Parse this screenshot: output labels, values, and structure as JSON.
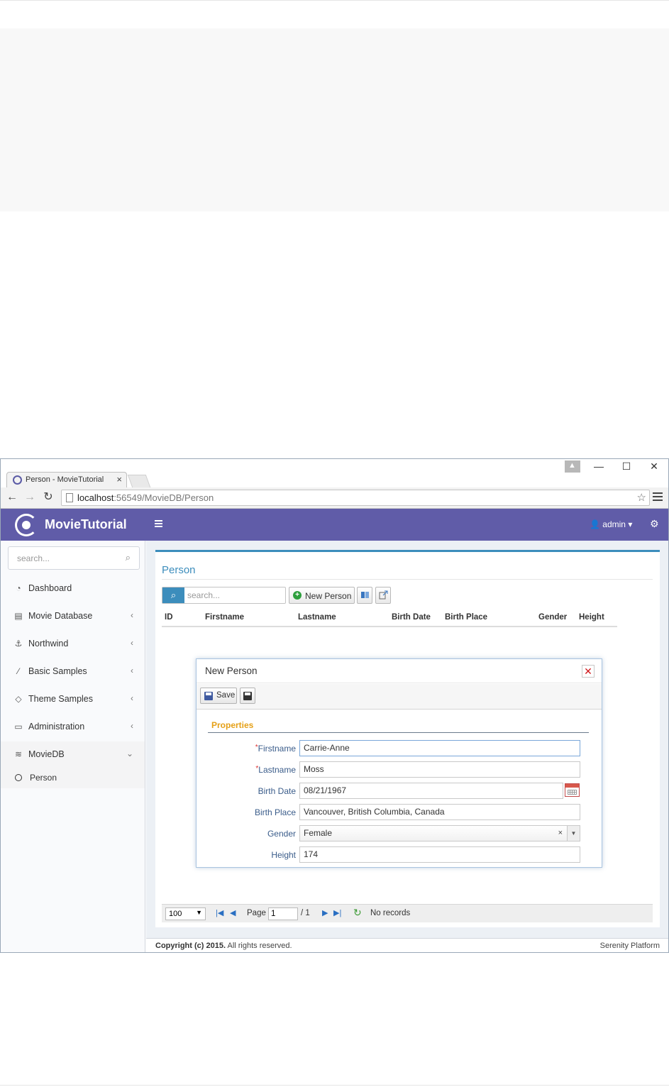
{
  "browser": {
    "tab_title": "Person - MovieTutorial",
    "tab_close": "×",
    "url_host": "localhost",
    "url_rest": ":56549/MovieDB/Person",
    "controls": {
      "minimize": "—",
      "maximize": "☐",
      "close": "✕"
    }
  },
  "app": {
    "logo_text": "MovieTutorial",
    "user_label": "admin",
    "accent_color": "#605ca8"
  },
  "sidebar": {
    "search_placeholder": "search...",
    "items": [
      {
        "label": "Dashboard",
        "icon": "dashboard-icon",
        "has_children": false
      },
      {
        "label": "Movie Database",
        "icon": "film-icon",
        "has_children": true
      },
      {
        "label": "Northwind",
        "icon": "anchor-icon",
        "has_children": true
      },
      {
        "label": "Basic Samples",
        "icon": "magic-wand-icon",
        "has_children": true
      },
      {
        "label": "Theme Samples",
        "icon": "diamond-icon",
        "has_children": true
      },
      {
        "label": "Administration",
        "icon": "desktop-icon",
        "has_children": true
      },
      {
        "label": "MovieDB",
        "icon": "stack-icon",
        "has_children": true,
        "expanded": true
      }
    ],
    "sub_items": [
      {
        "label": "Person",
        "icon": "circle-icon"
      }
    ]
  },
  "grid": {
    "title": "Person",
    "search_placeholder": "search...",
    "new_button": "New Person",
    "columns": [
      "ID",
      "Firstname",
      "Lastname",
      "Birth Date",
      "Birth Place",
      "Gender",
      "Height"
    ]
  },
  "pager": {
    "page_size": "100",
    "page_label": "Page",
    "page_value": "1",
    "page_total": "/ 1",
    "status": "No records"
  },
  "dialog": {
    "title": "New Person",
    "save_label": "Save",
    "category": "Properties",
    "fields": [
      {
        "label": "Firstname",
        "required": true,
        "value": "Carrie-Anne"
      },
      {
        "label": "Lastname",
        "required": true,
        "value": "Moss"
      },
      {
        "label": "Birth Date",
        "required": false,
        "value": "08/21/1967"
      },
      {
        "label": "Birth Place",
        "required": false,
        "value": "Vancouver, British Columbia, Canada"
      },
      {
        "label": "Gender",
        "required": false,
        "value": "Female"
      },
      {
        "label": "Height",
        "required": false,
        "value": "174"
      }
    ]
  },
  "footer": {
    "copyright_bold": "Copyright (c) 2015.",
    "copyright_rest": " All rights reserved.",
    "platform": "Serenity Platform"
  }
}
